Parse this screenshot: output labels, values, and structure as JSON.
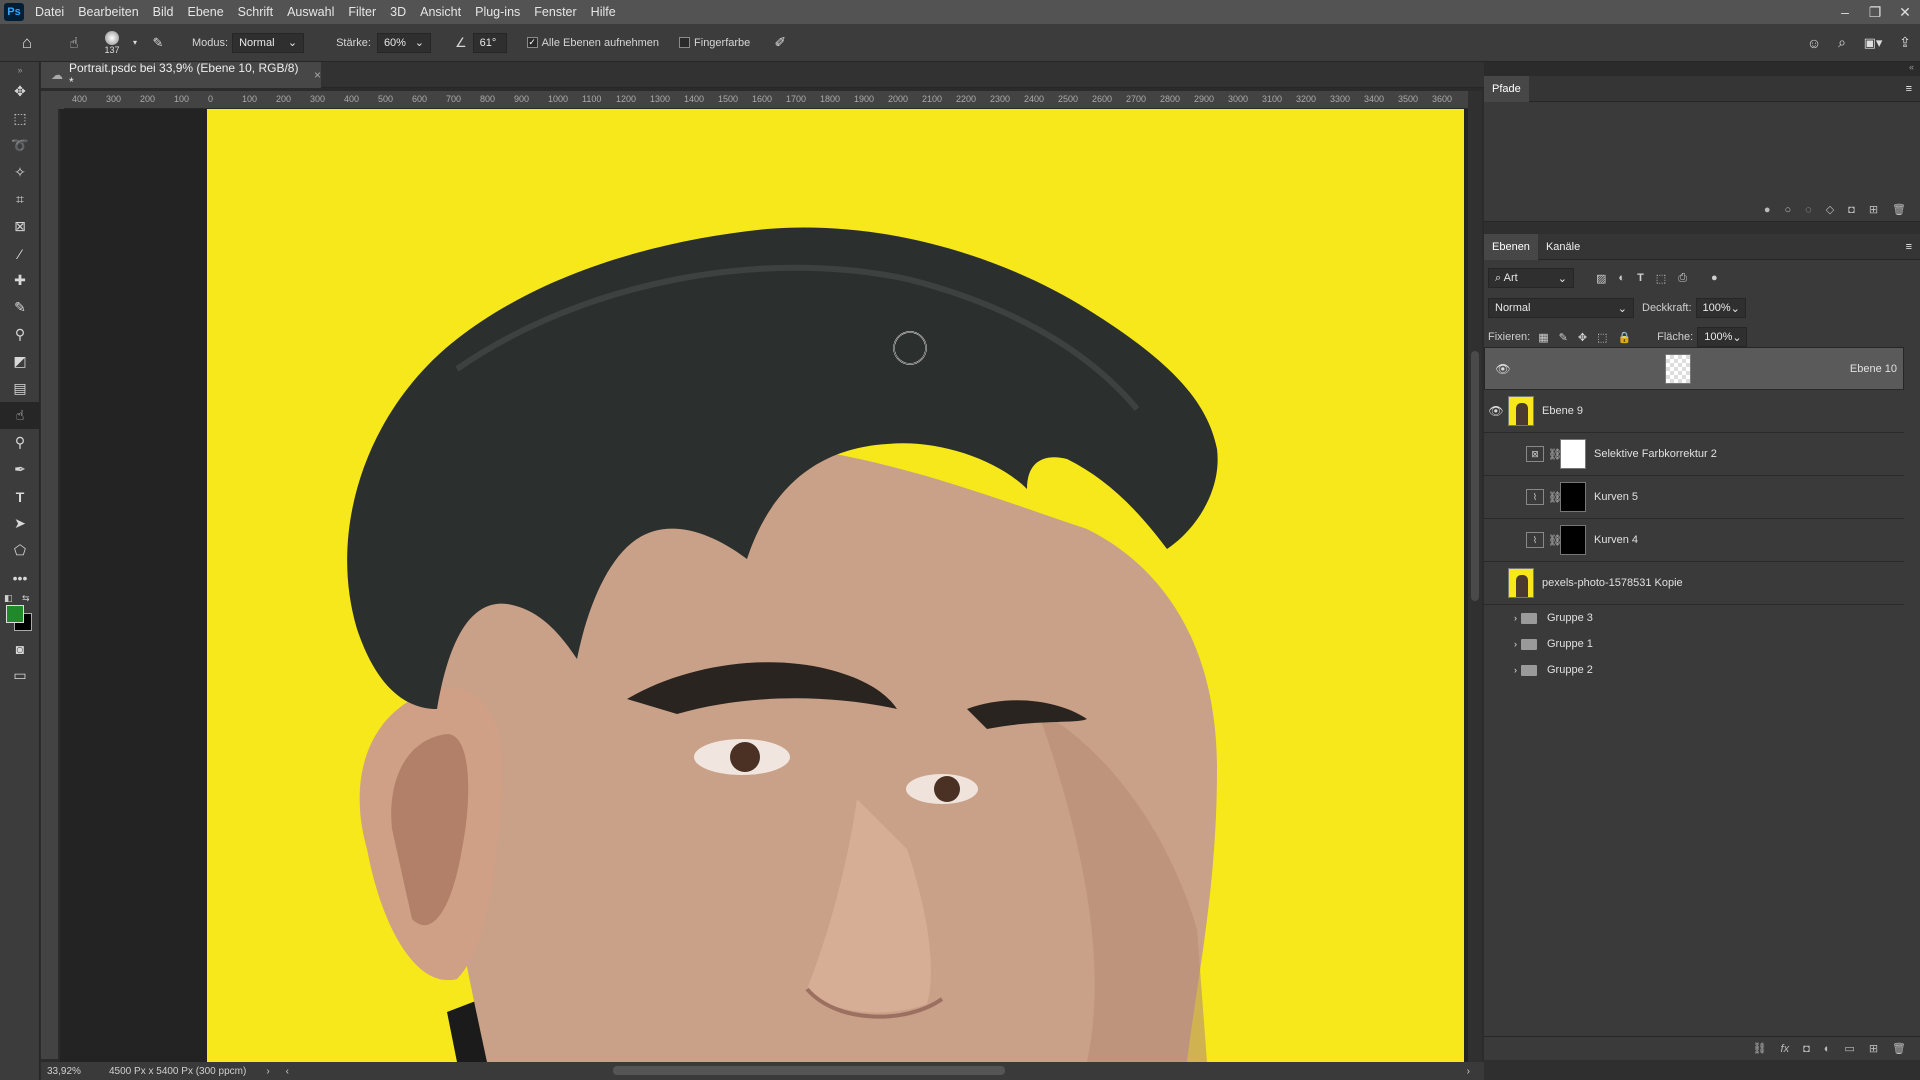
{
  "menu": {
    "app_badge": "Ps",
    "items": [
      "Datei",
      "Bearbeiten",
      "Bild",
      "Ebene",
      "Schrift",
      "Auswahl",
      "Filter",
      "3D",
      "Ansicht",
      "Plug-ins",
      "Fenster",
      "Hilfe"
    ]
  },
  "window_controls": {
    "minimize": "–",
    "restore": "❐",
    "close": "✕"
  },
  "options": {
    "brush_size": "137",
    "modus_label": "Modus:",
    "modus_value": "Normal",
    "staerke_label": "Stärke:",
    "staerke_value": "60%",
    "angle_value": "61°",
    "sample_all_label": "Alle Ebenen aufnehmen",
    "finger_paint_label": "Fingerfarbe"
  },
  "document": {
    "tab_title": "Portrait.psdc bei 33,9% (Ebene 10, RGB/8) *",
    "zoom": "33,92%",
    "doc_info": "4500 Px x 5400 Px (300 ppcm)"
  },
  "ruler": {
    "h_ticks": [
      "400",
      "300",
      "200",
      "100",
      "0",
      "100",
      "200",
      "300",
      "400",
      "500",
      "600",
      "700",
      "800",
      "900",
      "1000",
      "1100",
      "1200",
      "1300",
      "1400",
      "1500",
      "1600",
      "1700",
      "1800",
      "1900",
      "2000",
      "2100",
      "2200",
      "2300",
      "2400",
      "2500",
      "2600",
      "2700",
      "2800",
      "2900",
      "3000",
      "3100",
      "3200",
      "3300",
      "3400",
      "3500",
      "3600"
    ]
  },
  "paths_panel": {
    "tab": "Pfade"
  },
  "layers_panel": {
    "tabs": [
      "Ebenen",
      "Kanäle"
    ],
    "filter_label": "Art",
    "blend_mode": "Normal",
    "opacity_label": "Deckkraft:",
    "opacity_value": "100%",
    "lock_label": "Fixieren:",
    "fill_label": "Fläche:",
    "fill_value": "100%",
    "layers": [
      {
        "name": "Ebene 10",
        "visible": true,
        "selected": true,
        "kind": "pixel-transparent"
      },
      {
        "name": "Ebene 9",
        "visible": true,
        "selected": false,
        "kind": "photo"
      },
      {
        "name": "Selektive Farbkorrektur 2",
        "visible": false,
        "selected": false,
        "kind": "adjustment-white"
      },
      {
        "name": "Kurven 5",
        "visible": false,
        "selected": false,
        "kind": "adjustment-black"
      },
      {
        "name": "Kurven 4",
        "visible": false,
        "selected": false,
        "kind": "adjustment-black"
      },
      {
        "name": "pexels-photo-1578531 Kopie",
        "visible": false,
        "selected": false,
        "kind": "photo"
      }
    ],
    "groups": [
      "Gruppe 3",
      "Gruppe 1",
      "Gruppe 2"
    ]
  },
  "colors": {
    "background_yellow": "#f6e81a",
    "hair": "#2b2f2d",
    "skin": "#c79f87",
    "foreground_swatch": "#1f8a2a",
    "background_swatch": "#000000"
  }
}
